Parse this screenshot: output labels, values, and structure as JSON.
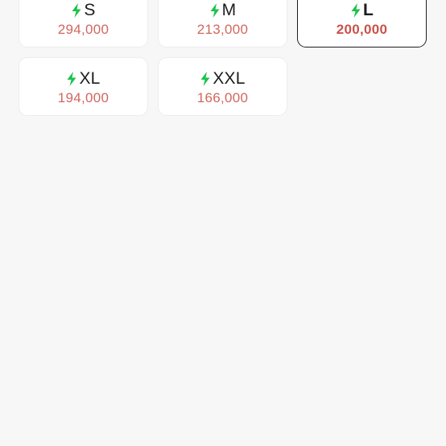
{
  "colors": {
    "bolt": "#19c24a",
    "price": "#d0675f",
    "selected_border": "#1e1e1e"
  },
  "sizes": [
    {
      "label": "S",
      "price": "294,000",
      "icon": "bolt-icon",
      "selected": false
    },
    {
      "label": "M",
      "price": "213,000",
      "icon": "bolt-icon",
      "selected": false
    },
    {
      "label": "L",
      "price": "200,000",
      "icon": "bolt-icon",
      "selected": true
    },
    {
      "label": "XL",
      "price": "194,000",
      "icon": "bolt-icon",
      "selected": false
    },
    {
      "label": "XXL",
      "price": "166,000",
      "icon": "bolt-icon",
      "selected": false
    }
  ]
}
